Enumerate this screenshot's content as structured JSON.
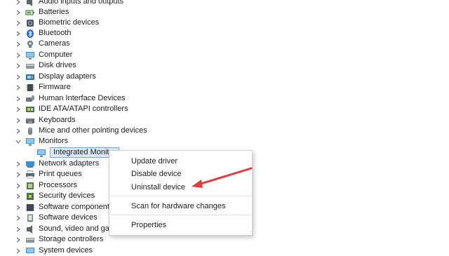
{
  "tree": {
    "items": [
      {
        "label": "Audio inputs and outputs",
        "icon": "speaker-icon"
      },
      {
        "label": "Batteries",
        "icon": "battery-icon"
      },
      {
        "label": "Biometric devices",
        "icon": "fingerprint-icon"
      },
      {
        "label": "Bluetooth",
        "icon": "bluetooth-icon"
      },
      {
        "label": "Cameras",
        "icon": "camera-icon"
      },
      {
        "label": "Computer",
        "icon": "computer-icon"
      },
      {
        "label": "Disk drives",
        "icon": "disk-drive-icon"
      },
      {
        "label": "Display adapters",
        "icon": "display-adapter-icon"
      },
      {
        "label": "Firmware",
        "icon": "firmware-icon"
      },
      {
        "label": "Human Interface Devices",
        "icon": "hid-icon"
      },
      {
        "label": "IDE ATA/ATAPI controllers",
        "icon": "ide-controller-icon"
      },
      {
        "label": "Keyboards",
        "icon": "keyboard-icon"
      },
      {
        "label": "Mice and other pointing devices",
        "icon": "mouse-icon"
      },
      {
        "label": "Monitors",
        "icon": "monitor-icon",
        "expanded": true
      },
      {
        "label": "Network adapters",
        "icon": "network-adapter-icon"
      },
      {
        "label": "Print queues",
        "icon": "printer-icon"
      },
      {
        "label": "Processors",
        "icon": "processor-icon"
      },
      {
        "label": "Security devices",
        "icon": "security-device-icon"
      },
      {
        "label": "Software components",
        "icon": "software-component-icon"
      },
      {
        "label": "Software devices",
        "icon": "software-device-icon"
      },
      {
        "label": "Sound, video and game controllers",
        "icon": "speaker-icon"
      },
      {
        "label": "Storage controllers",
        "icon": "storage-controller-icon"
      },
      {
        "label": "System devices",
        "icon": "system-device-icon"
      }
    ],
    "selected_child": {
      "label": "Integrated Monitor",
      "icon": "monitor-icon"
    }
  },
  "context_menu": {
    "items": [
      "Update driver",
      "Disable device",
      "Uninstall device",
      "Scan for hardware changes",
      "Properties"
    ]
  },
  "colors": {
    "selection_fill": "#dbe9f7",
    "selection_border": "#7aa7d4",
    "annotation_arrow": "#e23b3b"
  }
}
